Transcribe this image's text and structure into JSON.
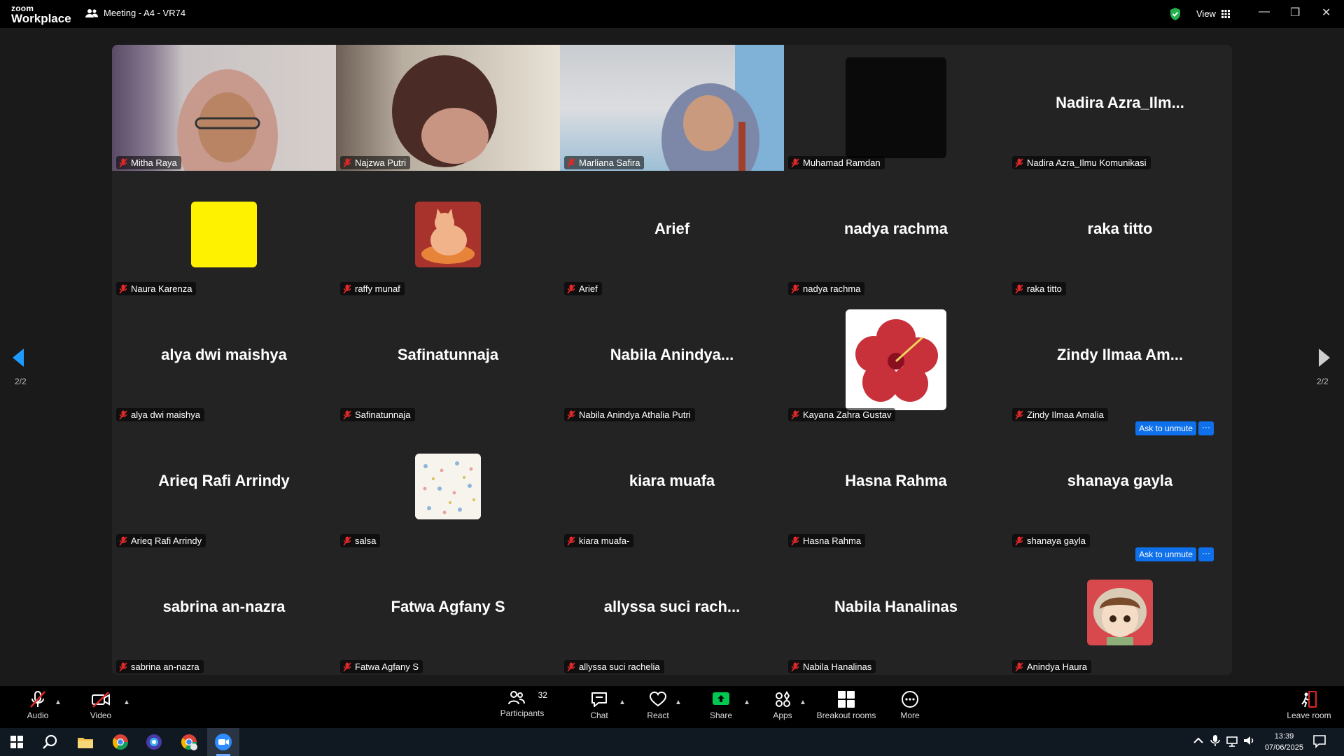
{
  "app": {
    "logo_line1": "zoom",
    "logo_line2": "Workplace",
    "meeting_title": "Meeting - A4 - VR74",
    "view_label": "View"
  },
  "colors": {
    "accent": "#0e71eb",
    "mute_red": "#e02828",
    "share_green": "#00c851",
    "shield_green": "#22b14c"
  },
  "pagination": {
    "left": "2/2",
    "right": "2/2"
  },
  "tiles": [
    {
      "name": "Mitha Raya",
      "display": "",
      "kind": "video"
    },
    {
      "name": "Najzwa Putri",
      "display": "",
      "kind": "video"
    },
    {
      "name": "Marliana Safira",
      "display": "",
      "kind": "video"
    },
    {
      "name": "Muhamad Ramdan",
      "display": "",
      "kind": "black"
    },
    {
      "name": "Nadira Azra_Ilmu Komunikasi",
      "display": "Nadira  Azra_Ilm...",
      "kind": "text"
    },
    {
      "name": "Naura Karenza",
      "display": "",
      "kind": "yellow"
    },
    {
      "name": "raffy munaf",
      "display": "",
      "kind": "cat"
    },
    {
      "name": "Arief",
      "display": "Arief",
      "kind": "text"
    },
    {
      "name": "nadya rachma",
      "display": "nadya rachma",
      "kind": "text"
    },
    {
      "name": "raka titto",
      "display": "raka titto",
      "kind": "text"
    },
    {
      "name": "alya dwi maishya",
      "display": "alya dwi maishya",
      "kind": "text"
    },
    {
      "name": "Safinatunnaja",
      "display": "Safinatunnaja",
      "kind": "text"
    },
    {
      "name": "Nabila Anindya Athalia Putri",
      "display": "Nabila  Anindya...",
      "kind": "text"
    },
    {
      "name": "Kayana Zahra Gustav",
      "display": "",
      "kind": "flower"
    },
    {
      "name": "Zindy Ilmaa Amalia",
      "display": "Zindy  Ilmaa  Am...",
      "kind": "text"
    },
    {
      "name": "Arieq Rafi Arrindy",
      "display": "Arieq Rafi Arrindy",
      "kind": "text"
    },
    {
      "name": "salsa",
      "display": "",
      "kind": "pattern"
    },
    {
      "name": "kiara muafa-",
      "display": "kiara muafa",
      "kind": "text"
    },
    {
      "name": "Hasna Rahma",
      "display": "Hasna Rahma",
      "kind": "text"
    },
    {
      "name": "shanaya gayla",
      "display": "shanaya gayla",
      "kind": "text"
    },
    {
      "name": "sabrina an-nazra",
      "display": "sabrina an-nazra",
      "kind": "text"
    },
    {
      "name": "Fatwa Agfany S",
      "display": "Fatwa Agfany S",
      "kind": "text"
    },
    {
      "name": "allyssa suci rachelia",
      "display": "allyssa suci rach...",
      "kind": "text"
    },
    {
      "name": "Nabila Hanalinas",
      "display": "Nabila Hanalinas",
      "kind": "text"
    },
    {
      "name": "Anindya Haura",
      "display": "",
      "kind": "cartoon"
    }
  ],
  "ask_unmute": {
    "label": "Ask to unmute",
    "more": "···"
  },
  "toolbar": {
    "audio": "Audio",
    "video": "Video",
    "participants": "Participants",
    "participants_count": "32",
    "chat": "Chat",
    "react": "React",
    "share": "Share",
    "apps": "Apps",
    "breakout": "Breakout rooms",
    "more": "More",
    "leave": "Leave room"
  },
  "taskbar": {
    "time": "13:39",
    "date": "07/06/2025"
  }
}
